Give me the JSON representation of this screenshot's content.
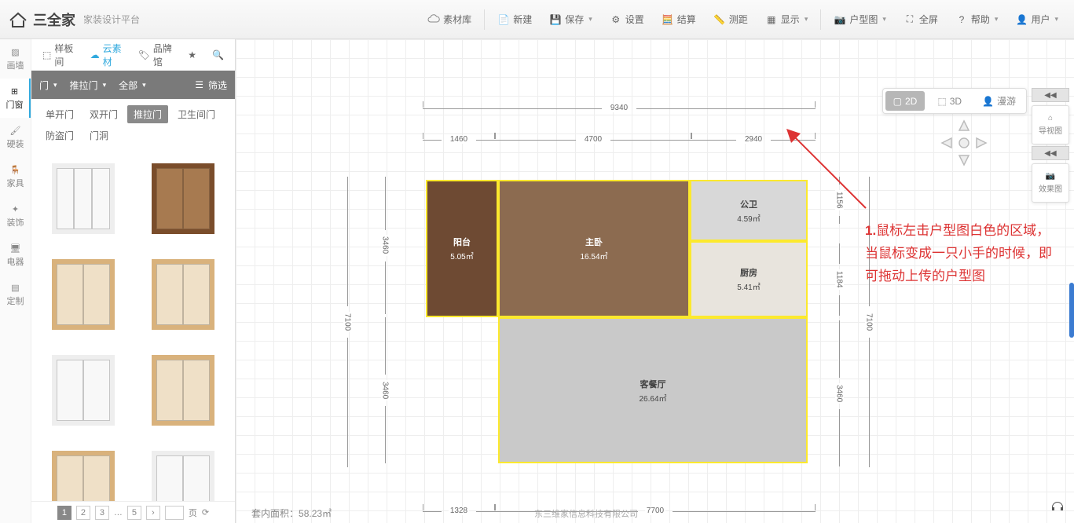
{
  "brand": {
    "name": "全家",
    "prefix": "三",
    "sub": "家装设计平台"
  },
  "topbar": {
    "material_lib": "素材库",
    "new": "新建",
    "save": "保存",
    "settings": "设置",
    "calculate": "结算",
    "measure": "测距",
    "display": "显示",
    "floorplan": "户型图",
    "fullscreen": "全屏",
    "help": "帮助",
    "user": "用户"
  },
  "side_tabs": {
    "wall": "画墙",
    "window": "门窗",
    "hard": "硬装",
    "furniture": "家具",
    "deco": "装饰",
    "appliance": "电器",
    "custom": "定制"
  },
  "source_tabs": {
    "sample": "样板间",
    "cloud": "云素材",
    "brand": "品牌馆"
  },
  "filter_row": {
    "door": "门",
    "slide": "推拉门",
    "all": "全部",
    "filter": "筛选"
  },
  "chips": [
    "单开门",
    "双开门",
    "推拉门",
    "卫生间门",
    "防盗门",
    "门洞"
  ],
  "pager": {
    "pages": [
      "1",
      "2",
      "3"
    ],
    "last": "5",
    "unit": "页"
  },
  "viewbar": {
    "twoD": "2D",
    "threeD": "3D",
    "roam": "漫游"
  },
  "nav": {
    "guide": "导视图",
    "render": "效果图"
  },
  "rooms": {
    "balcony": {
      "name": "阳台",
      "area": "5.05㎡"
    },
    "master": {
      "name": "主卧",
      "area": "16.54㎡"
    },
    "bath": {
      "name": "公卫",
      "area": "4.59㎡"
    },
    "kitchen": {
      "name": "厨房",
      "area": "5.41㎡"
    },
    "living": {
      "name": "客餐厅",
      "area": "26.64㎡"
    }
  },
  "dims": {
    "top_total": "9340",
    "top_a": "1460",
    "top_b": "4700",
    "top_c": "2940",
    "left_a": "3460",
    "left_b": "7100",
    "left_c": "3460",
    "right_a": "1156",
    "right_b": "1184",
    "right_c": "7100",
    "right_d": "3460",
    "bot_a": "1328",
    "bot_b": "7700"
  },
  "footer": {
    "area_label": "套内面积：",
    "area_value": "58.23㎡"
  },
  "watermark": "东三维家信息科技有限公司",
  "annotation": {
    "num": "1.",
    "text": "鼠标左击户型图白色的区域，当鼠标变成一只小手的时候，即可拖动上传的户型图"
  }
}
